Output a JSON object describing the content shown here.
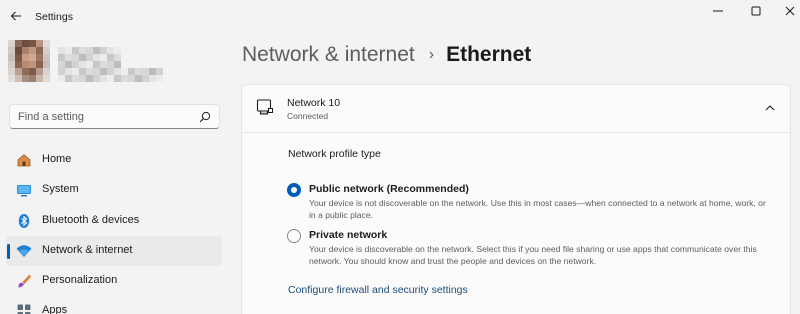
{
  "app": {
    "title": "Settings"
  },
  "search": {
    "placeholder": "Find a setting"
  },
  "sidebar": {
    "items": [
      {
        "label": "Home",
        "icon": "home-icon",
        "active": false
      },
      {
        "label": "System",
        "icon": "monitor-icon",
        "active": false
      },
      {
        "label": "Bluetooth & devices",
        "icon": "bluetooth-icon",
        "active": false
      },
      {
        "label": "Network & internet",
        "icon": "wifi-icon",
        "active": true
      },
      {
        "label": "Personalization",
        "icon": "brush-icon",
        "active": false
      },
      {
        "label": "Apps",
        "icon": "apps-icon",
        "active": false
      }
    ]
  },
  "breadcrumb": {
    "parent": "Network & internet",
    "separator": "›",
    "current": "Ethernet"
  },
  "network": {
    "name": "Network 10",
    "status": "Connected",
    "profile_type_label": "Network profile type",
    "options": [
      {
        "label": "Public network (Recommended)",
        "description": "Your device is not discoverable on the network. Use this in most cases—when connected to a network at home, work, or in a public place.",
        "selected": true
      },
      {
        "label": "Private network",
        "description": "Your device is discoverable on the network. Select this if you need file sharing or use apps that communicate over this network. You should know and trust the people and devices on the network.",
        "selected": false
      }
    ],
    "firewall_link": "Configure firewall and security settings"
  },
  "colors": {
    "accent": "#005fb8",
    "window_bg": "#f3f3f3",
    "card_bg": "#fbfbfb",
    "link": "#1b4a78"
  }
}
